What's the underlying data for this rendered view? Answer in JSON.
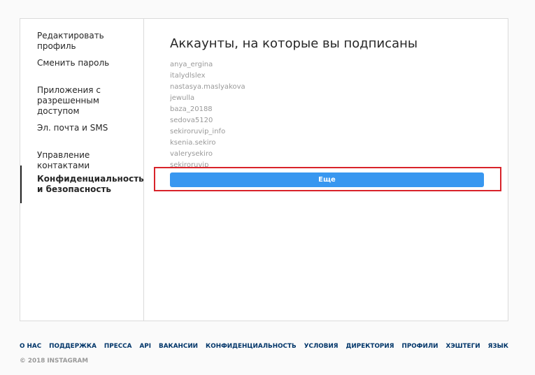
{
  "sidebar": {
    "items": [
      {
        "label": "Редактировать профиль"
      },
      {
        "label": "Сменить пароль"
      },
      {
        "label": "Приложения с разрешенным доступом"
      },
      {
        "label": "Эл. почта и SMS"
      },
      {
        "label": "Управление контактами"
      },
      {
        "label": "Конфиденциальность и безопасность"
      }
    ],
    "active_item": "Конфиденциальность и безопасность"
  },
  "main": {
    "title": "Аккаунты, на которые вы подписаны",
    "accounts": [
      "anya_ergina",
      "italydlslex",
      "nastasya.maslyakova",
      "jewulla",
      "baza_20188",
      "sedova5120",
      "sekiroruvip_info",
      "ksenia.sekiro",
      "valerysekiro",
      "sekiroruvip"
    ],
    "more_button_label": "Еще"
  },
  "footer": {
    "links": [
      "О НАС",
      "ПОДДЕРЖКА",
      "ПРЕССА",
      "API",
      "ВАКАНСИИ",
      "КОНФИДЕНЦИАЛЬНОСТЬ",
      "УСЛОВИЯ",
      "ДИРЕКТОРИЯ",
      "ПРОФИЛИ",
      "ХЭШТЕГИ",
      "ЯЗЫК"
    ],
    "copyright": "© 2018 INSTAGRAM"
  },
  "colors": {
    "accent": "#3897f0",
    "highlight": "#d8232a",
    "link": "#003569",
    "muted": "#999999"
  }
}
